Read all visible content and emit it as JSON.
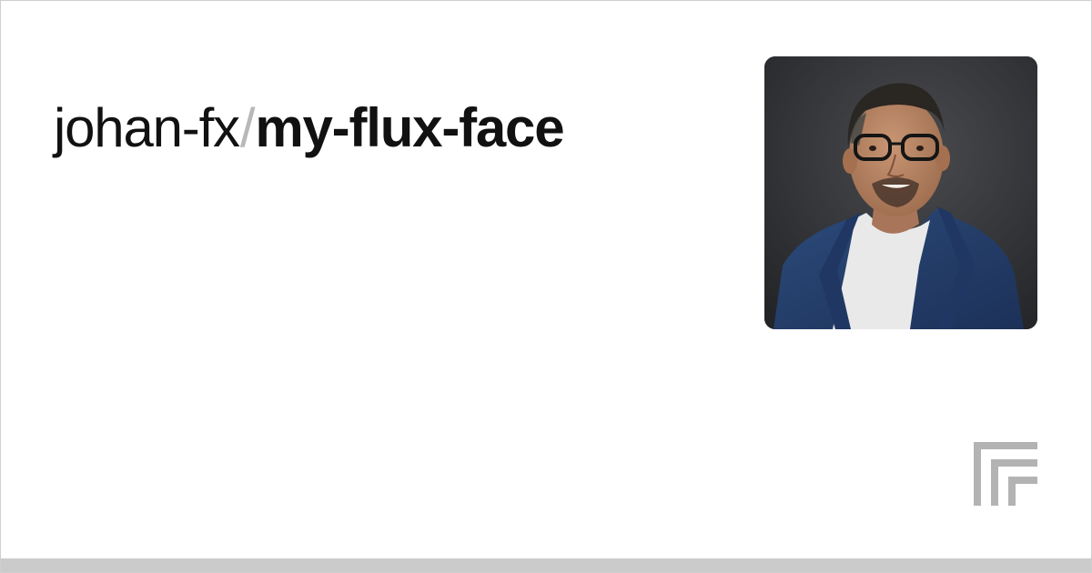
{
  "header": {
    "owner": "johan-fx",
    "separator": "/",
    "model": "my-flux-face"
  },
  "avatar": {
    "icon": "person-portrait-photo"
  },
  "brand": {
    "icon": "replicate-logo-icon",
    "logo_color": "#b3b3b3"
  },
  "colors": {
    "background": "#ffffff",
    "text": "#111111",
    "separator": "#b8b8b8",
    "bottom_bar": "#cbcbcb"
  }
}
